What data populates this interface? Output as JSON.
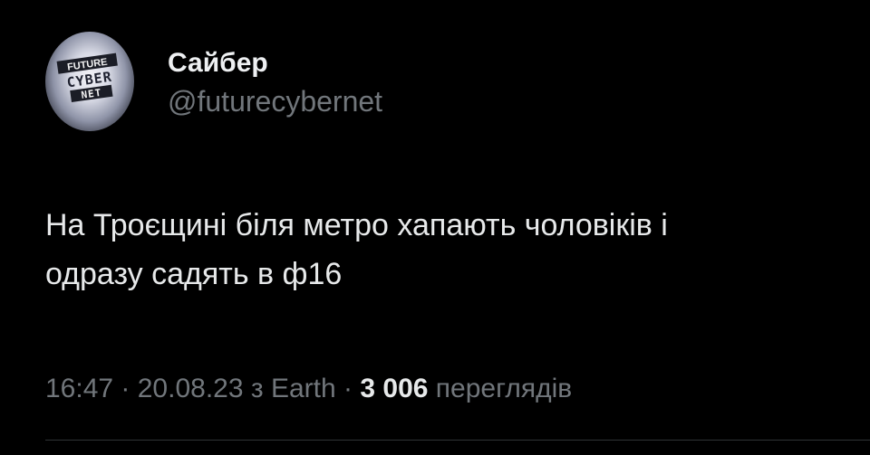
{
  "author": {
    "display_name": "Сайбер",
    "handle": "@futurecybernet",
    "avatar": {
      "line1": "FUTURE",
      "line2": "CYBER",
      "line3": "NET"
    }
  },
  "tweet": {
    "text_line1": "На Троєщині біля метро хапають чоловіків і",
    "text_line2": "одразу садять в ф16"
  },
  "meta": {
    "time": "16:47",
    "sep1": " · ",
    "date": "20.08.23",
    "via_prefix": " з ",
    "source": "Earth",
    "sep2": " · ",
    "views_count": "3 006",
    "views_label": " переглядів"
  },
  "colors": {
    "background": "#000000",
    "text": "#e7e9ea",
    "secondary": "#71767b",
    "divider": "#2f3336"
  }
}
